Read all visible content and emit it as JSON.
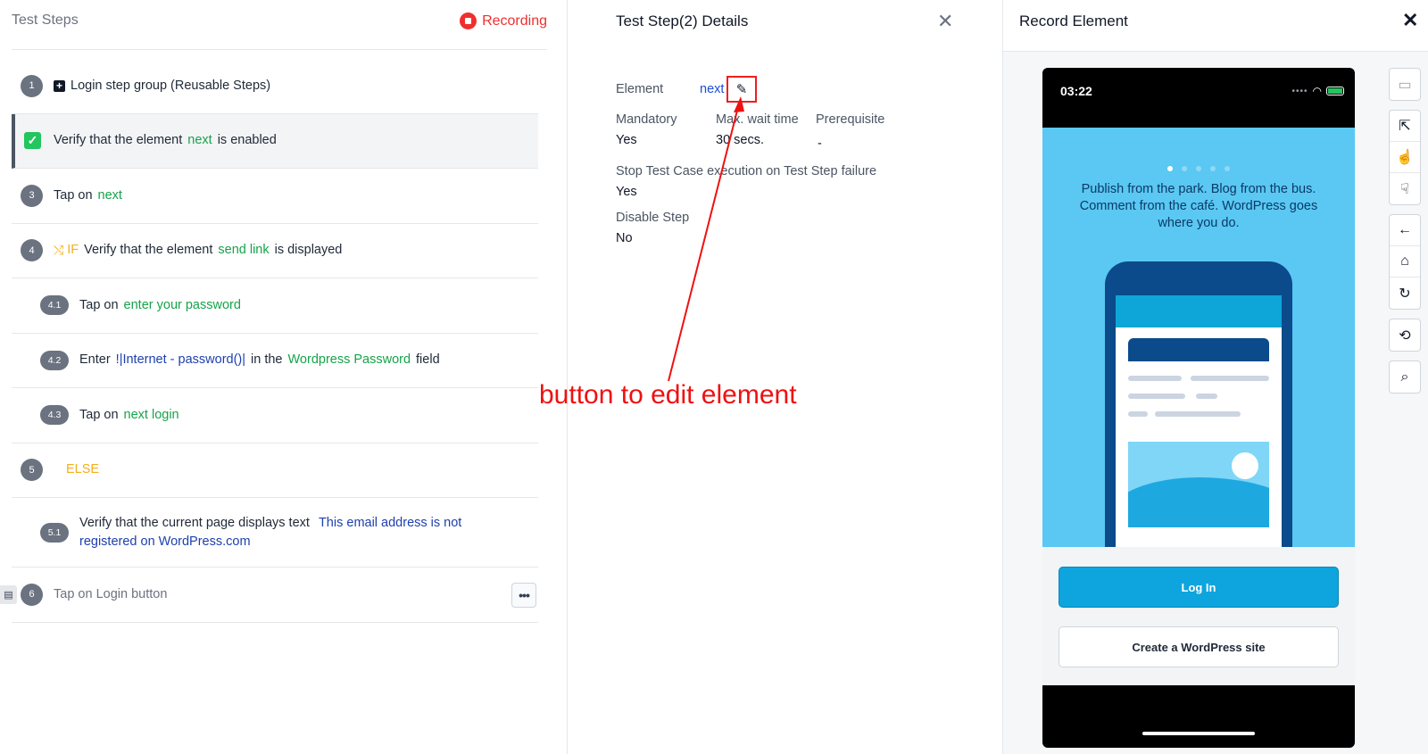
{
  "steps_panel": {
    "title": "Test Steps",
    "recording_label": "Recording",
    "steps": [
      {
        "num": "1",
        "text": "Login step group (Reusable Steps)"
      },
      {
        "pre": "Verify that the element",
        "element": "next",
        "post": "is enabled"
      },
      {
        "num": "3",
        "pre": "Tap on",
        "element": "next"
      },
      {
        "num": "4",
        "keyword": "IF",
        "pre": "Verify that the element",
        "element": "send link",
        "post": "is displayed"
      },
      {
        "num": "4.1",
        "pre": "Tap on",
        "element": "enter your password"
      },
      {
        "num": "4.2",
        "pre": "Enter",
        "data": "!|Internet - password()|",
        "mid": "in the",
        "element": "Wordpress Password",
        "post": "field"
      },
      {
        "num": "4.3",
        "pre": "Tap on",
        "element": "next login"
      },
      {
        "num": "5",
        "keyword": "ELSE"
      },
      {
        "num": "5.1",
        "pre": "Verify that the current page displays text",
        "data_line1": "This email address is not",
        "data_line2": "registered on WordPress.com"
      },
      {
        "num": "6",
        "text": "Tap on Login button"
      }
    ]
  },
  "details_panel": {
    "title": "Test Step(2) Details",
    "element_label": "Element",
    "element_value": "next",
    "mandatory_label": "Mandatory",
    "mandatory_value": "Yes",
    "wait_label": "Max. wait time",
    "wait_value": "30 secs.",
    "prereq_label": "Prerequisite",
    "prereq_value": "-",
    "stop_label": "Stop Test Case execution on Test Step failure",
    "stop_value": "Yes",
    "disable_label": "Disable Step",
    "disable_value": "No"
  },
  "annotation": {
    "text": "button to edit element",
    "color": "#ee1111"
  },
  "record_panel": {
    "title": "Record Element",
    "device_time": "03:22",
    "slogan": "Publish from the park. Blog from the bus. Comment from the café. WordPress goes where you do.",
    "login_button": "Log In",
    "create_button": "Create a WordPress site",
    "pager_active_index": 0,
    "pager_count": 5
  },
  "icons": {
    "toolbar": [
      "devices-icon",
      "select-cursor-icon",
      "tap-icon",
      "swipe-icon",
      "back-arrow-icon",
      "home-icon",
      "refresh-icon",
      "rotate-icon",
      "search-icon"
    ]
  }
}
